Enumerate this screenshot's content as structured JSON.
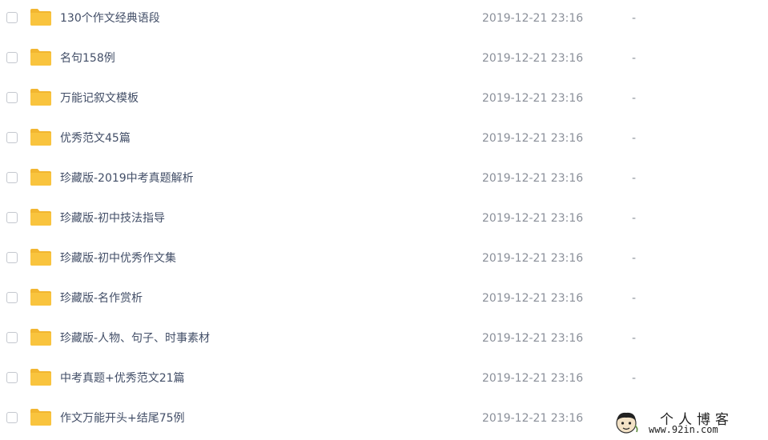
{
  "colors": {
    "folder": "#f9c43e",
    "folder_tab": "#f2b630",
    "name_text": "#424e67",
    "meta_text": "#8b909a"
  },
  "file_list": {
    "items": [
      {
        "icon": "folder-icon",
        "name": "130个作文经典语段",
        "date": "2019-12-21 23:16",
        "size": "-"
      },
      {
        "icon": "folder-icon",
        "name": "名句158例",
        "date": "2019-12-21 23:16",
        "size": "-"
      },
      {
        "icon": "folder-icon",
        "name": "万能记叙文模板",
        "date": "2019-12-21 23:16",
        "size": "-"
      },
      {
        "icon": "folder-icon",
        "name": "优秀范文45篇",
        "date": "2019-12-21 23:16",
        "size": "-"
      },
      {
        "icon": "folder-icon",
        "name": "珍藏版-2019中考真题解析",
        "date": "2019-12-21 23:16",
        "size": "-"
      },
      {
        "icon": "folder-icon",
        "name": "珍藏版-初中技法指导",
        "date": "2019-12-21 23:16",
        "size": "-"
      },
      {
        "icon": "folder-icon",
        "name": "珍藏版-初中优秀作文集",
        "date": "2019-12-21 23:16",
        "size": "-"
      },
      {
        "icon": "folder-icon",
        "name": "珍藏版-名作赏析",
        "date": "2019-12-21 23:16",
        "size": "-"
      },
      {
        "icon": "folder-icon",
        "name": "珍藏版-人物、句子、时事素材",
        "date": "2019-12-21 23:16",
        "size": "-"
      },
      {
        "icon": "folder-icon",
        "name": "中考真题+优秀范文21篇",
        "date": "2019-12-21 23:16",
        "size": "-"
      },
      {
        "icon": "folder-icon",
        "name": "作文万能开头+结尾75例",
        "date": "2019-12-21 23:16",
        "size": ""
      }
    ]
  },
  "watermark": {
    "title": "个人博客",
    "url": "www.92in.com"
  }
}
